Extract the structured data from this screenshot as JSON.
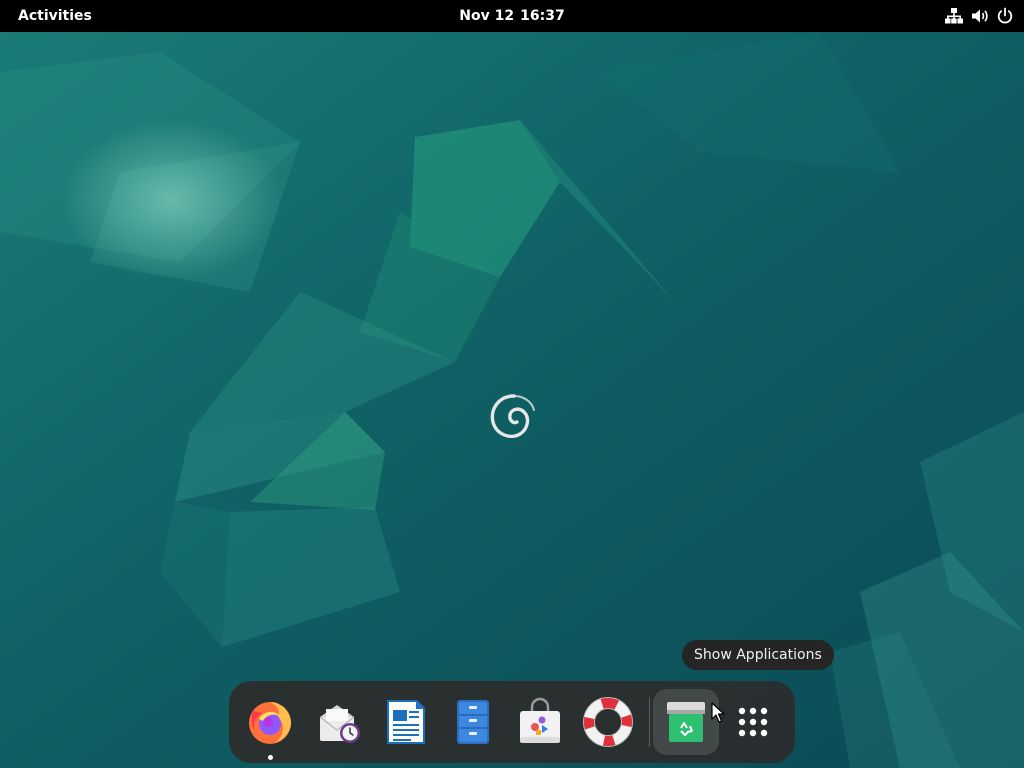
{
  "topbar": {
    "activities_label": "Activities",
    "date": "Nov 12",
    "time": "16:37",
    "status_icons": [
      "network-wired-icon",
      "volume-icon",
      "power-icon"
    ]
  },
  "desktop": {
    "wallpaper": "debian-emerald-wallpaper",
    "center_logo": "debian-swirl-icon"
  },
  "tooltip": {
    "text": "Show Applications"
  },
  "dock": {
    "items": [
      {
        "icon": "firefox-icon",
        "running": true
      },
      {
        "icon": "mail-clock-icon",
        "running": false
      },
      {
        "icon": "writer-document-icon",
        "running": false
      },
      {
        "icon": "file-cabinet-icon",
        "running": false
      },
      {
        "icon": "software-store-icon",
        "running": false
      },
      {
        "icon": "help-lifebuoy-icon",
        "running": false
      },
      {
        "icon": "trash-recycle-icon",
        "running": false,
        "hovered": true
      },
      {
        "icon": "show-applications-grid-icon",
        "running": false
      }
    ]
  },
  "colors": {
    "topbar_bg": "#000000",
    "wallpaper_base": "#0e5a5f",
    "wallpaper_accent": "#1e8a78",
    "dock_bg": "#2d2d2d",
    "tooltip_bg": "#252525"
  }
}
